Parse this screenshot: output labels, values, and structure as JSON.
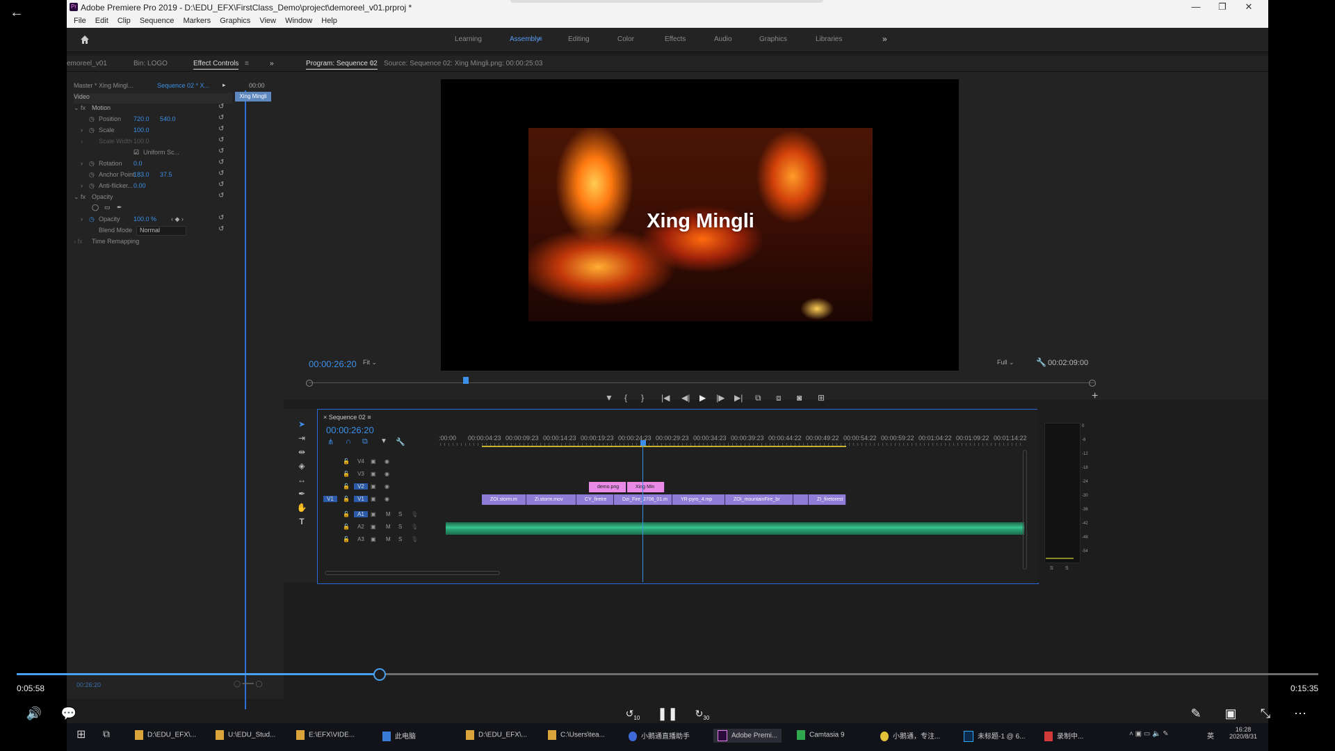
{
  "window": {
    "title": "Adobe Premiere Pro 2019 - D:\\EDU_EFX\\FirstClass_Demo\\project\\demoreel_v01.prproj *",
    "minimize": "—",
    "maximize": "❐",
    "close": "✕"
  },
  "menu": [
    "File",
    "Edit",
    "Clip",
    "Sequence",
    "Markers",
    "Graphics",
    "View",
    "Window",
    "Help"
  ],
  "workspaces": [
    "Learning",
    "Assembly",
    "Editing",
    "Color",
    "Effects",
    "Audio",
    "Graphics",
    "Libraries"
  ],
  "workspace_active": "Assembly",
  "workspace_more": "»",
  "left_panel": {
    "tabs": [
      "emoreel_v01",
      "Bin: LOGO",
      "Effect Controls"
    ],
    "more": "»",
    "master_label": "Master * Xing Mingl...",
    "sequence_label": "Sequence 02 * X...",
    "mini_time": "00:00",
    "clip_chip": "Xing Mingli",
    "section_video": "Video",
    "rows": {
      "motion": "Motion",
      "position_label": "Position",
      "position_x": "720.0",
      "position_y": "540.0",
      "scale_label": "Scale",
      "scale_val": "100.0",
      "scale_width_label": "Scale Width",
      "scale_width_val": "100.0",
      "uniform": "Uniform Sc...",
      "rotation_label": "Rotation",
      "rotation_val": "0.0",
      "anchor_label": "Anchor Point",
      "anchor_x": "183.0",
      "anchor_y": "37.5",
      "antiflicker_label": "Anti-flicker...",
      "antiflicker_val": "0.00",
      "opacity_section": "Opacity",
      "opacity_label": "Opacity",
      "opacity_val": "100.0 %",
      "blend_label": "Blend Mode",
      "blend_val": "Normal",
      "time_remap": "Time Remapping"
    },
    "bottom_time": "00:26:20"
  },
  "program_monitor": {
    "tab": "Program: Sequence 02",
    "source": "Source: Sequence 02: Xing Mingli.png: 00:00:25:03",
    "overlay_text": "Xing Mingli",
    "timecode": "00:00:26:20",
    "fit": "Fit",
    "quality": "Full",
    "duration": "00:02:09:00",
    "transport": [
      "▼",
      "{",
      "}",
      "|◀",
      "◀|",
      "▶",
      "|▶",
      "▶|",
      "⧉",
      "⧈",
      "◙",
      "⊞"
    ],
    "add": "+"
  },
  "timeline": {
    "sequence_name": "Sequence 02",
    "timecode": "00:00:26:20",
    "ruler": [
      ":00:00",
      "00:00:04:23",
      "00:00:09:23",
      "00:00:14:23",
      "00:00:19:23",
      "00:00:24:23",
      "00:00:29:23",
      "00:00:34:23",
      "00:00:39:23",
      "00:00:44:22",
      "00:00:49:22",
      "00:00:54:22",
      "00:00:59:22",
      "00:01:04:22",
      "00:01:09:22",
      "00:01:14:22"
    ],
    "tracks": [
      "V4",
      "V3",
      "V2",
      "V1",
      "A1",
      "A2",
      "A3"
    ],
    "source_patch": "V1",
    "track_letters": {
      "m": "M",
      "s": "S"
    },
    "v2_clips": [
      "demo.png",
      "Xing Min"
    ],
    "v1_clips": [
      "ZOI.storm.m",
      "Zi.storm.mov",
      "CY_firetre",
      "Dzi_Fire_2708_01.m",
      "YR-pyro_4.mp",
      "ZOI_mountainFire_br",
      "",
      "ZI_firetorest"
    ],
    "meter_scale": [
      "0",
      "-6",
      "-12",
      "-18",
      "-24",
      "-30",
      "-36",
      "-42",
      "-48",
      "-54"
    ],
    "meter_labels": [
      "S",
      "S"
    ]
  },
  "player": {
    "current": "0:05:58",
    "total": "0:15:35",
    "progress": 0.383,
    "skip_back": "10",
    "skip_fwd": "30"
  },
  "taskbar": {
    "items": [
      "D:\\EDU_EFX\\...",
      "U:\\EDU_Stud...",
      "E:\\EFX\\VIDE...",
      "此电脑",
      "D:\\EDU_EFX\\...",
      "C:\\Users\\tea...",
      "小鹅通直播助手",
      "Adobe Premi...",
      "Camtasia 9",
      "小鹅通，专注...",
      "未标题-1 @ 6...",
      "录制中..."
    ],
    "time": "16:28",
    "date": "2020/8/31",
    "ime": "英"
  },
  "colors": {
    "accent": "#3c8fe8",
    "clip_v1": "#8e7cd6",
    "clip_v2": "#e98ae6",
    "audio": "#38c790",
    "playhead": "#3c8fe8"
  }
}
